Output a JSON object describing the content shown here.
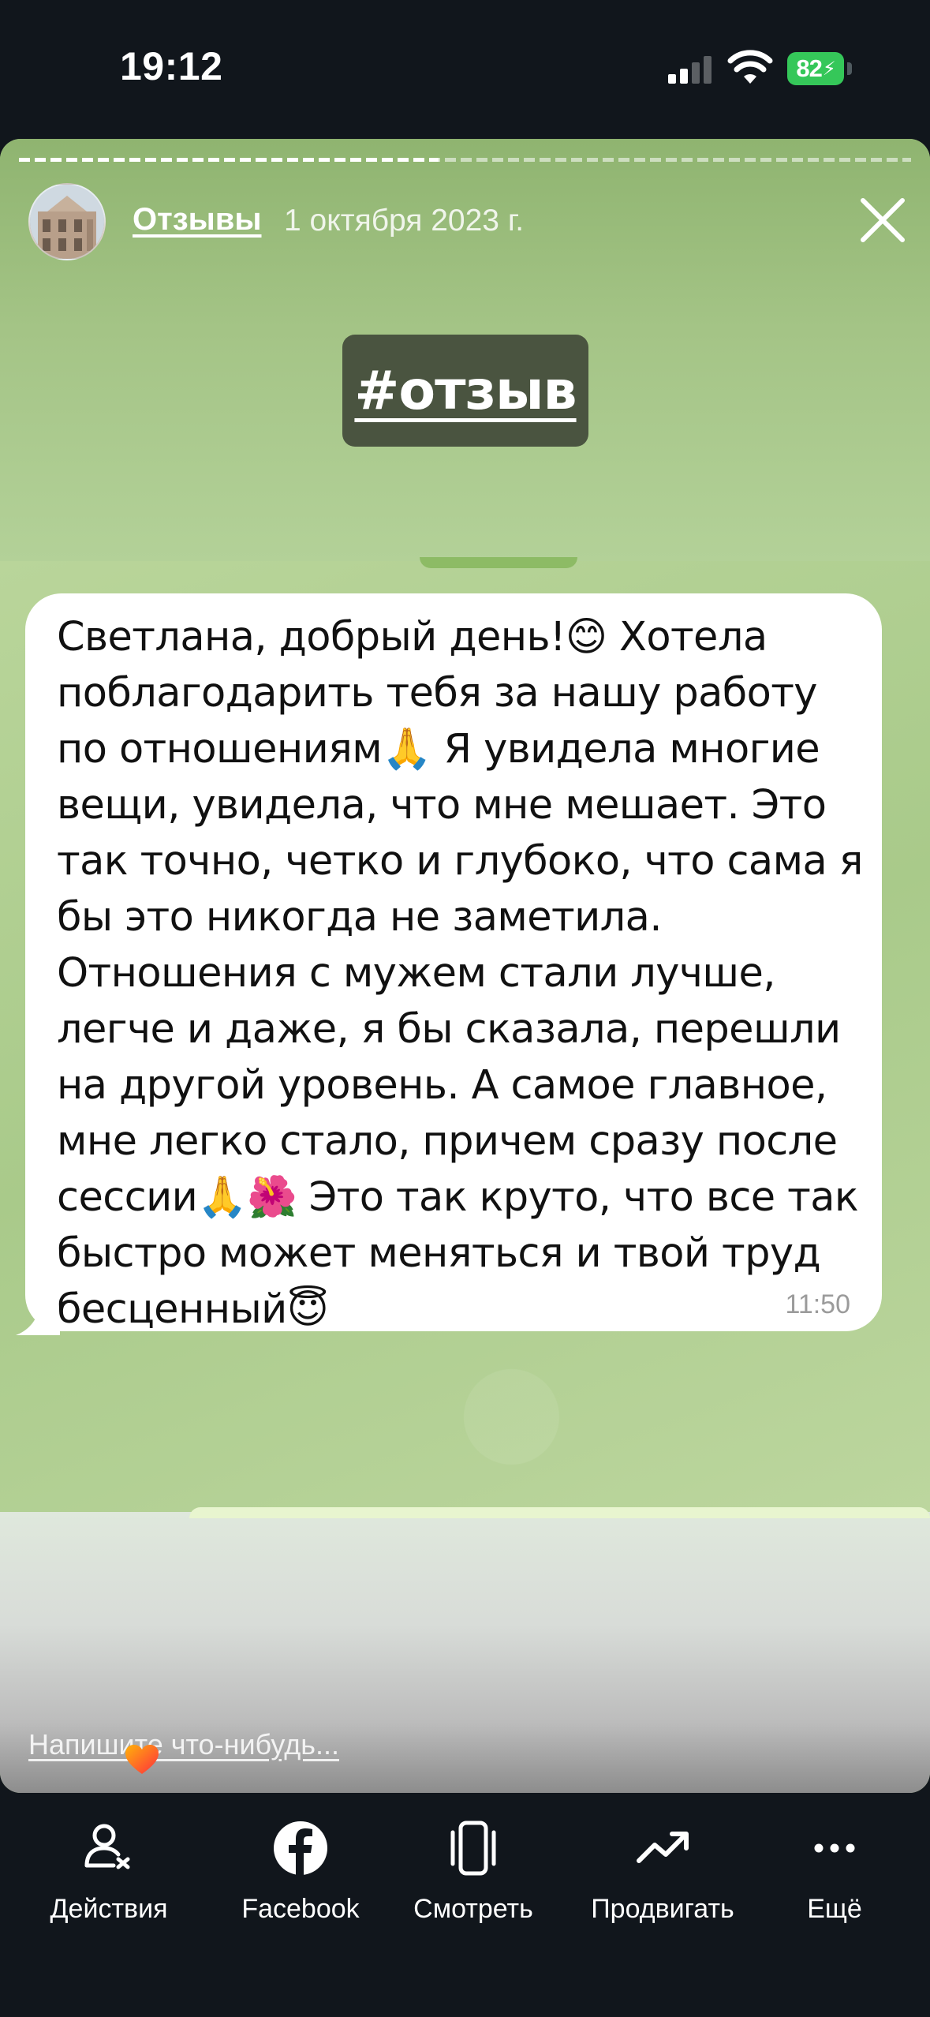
{
  "status_bar": {
    "time": "19:12",
    "battery": "82",
    "icons": [
      "signal-icon",
      "wifi-icon",
      "battery-icon"
    ]
  },
  "story": {
    "channel_name": "Отзывы",
    "date": "1 октября 2023 г.",
    "hashtag": "#отзыв",
    "progress_fraction": 0.47,
    "message": {
      "text": "Светлана, добрый день!😊 Хотела поблагодарить тебя за нашу работу по отношениям🙏 Я увидела многие вещи, увидела, что мне мешает. Это так точно, четко и глубоко, что сама я бы это никогда не заметила. Отношения с мужем стали лучше, легче и даже, я бы сказала, перешли на другой уровень. А самое главное, мне легко стало, причем сразу после сессии🙏🌺 Это так круто, что все так быстро может меняться и твой труд бесценный😇",
      "time": "11:50"
    },
    "reply_placeholder": "Напишите что-нибудь..."
  },
  "bottom_nav": [
    {
      "label": "Действия",
      "icon": "actions-icon"
    },
    {
      "label": "Facebook",
      "icon": "facebook-icon"
    },
    {
      "label": "Смотреть",
      "icon": "watch-icon"
    },
    {
      "label": "Продвигать",
      "icon": "promote-icon"
    },
    {
      "label": "Ещё",
      "icon": "more-icon"
    }
  ],
  "colors": {
    "background": "#11161c",
    "battery_green": "#35c759",
    "story_green": "#a8c88a",
    "hashtag_bg": "#4a5440"
  }
}
